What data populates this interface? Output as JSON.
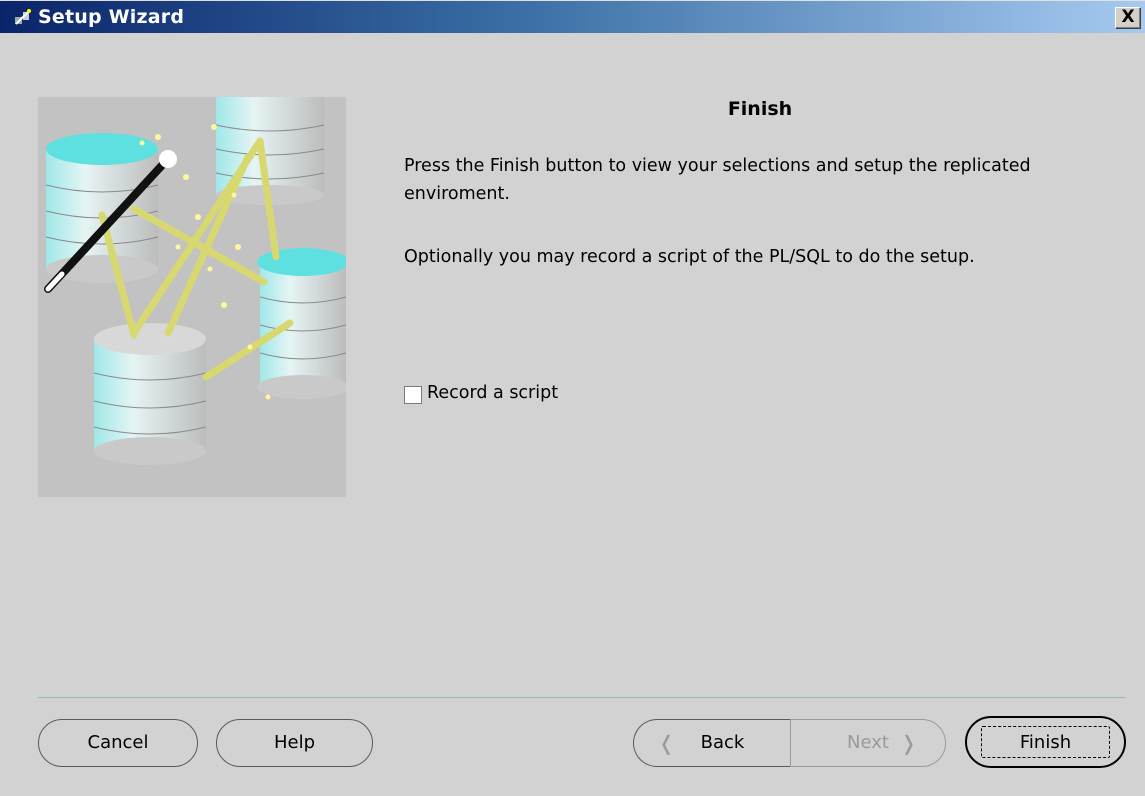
{
  "window": {
    "title": "Setup Wizard",
    "close_label": "X"
  },
  "page": {
    "heading": "Finish",
    "paragraph1": "Press the Finish button to view your selections and setup the replicated enviroment.",
    "paragraph2": "Optionally you may record a script of the PL/SQL to do the setup."
  },
  "options": {
    "record_script": {
      "label": "Record a script",
      "checked": false
    }
  },
  "buttons": {
    "cancel": "Cancel",
    "help": "Help",
    "back": "Back",
    "next": "Next",
    "finish": "Finish"
  },
  "icons": {
    "app": "wizard-icon",
    "back": "chevron-left-icon",
    "next": "chevron-right-icon"
  },
  "colors": {
    "title_start": "#0a246a",
    "title_end": "#a6caf0",
    "background": "#d2d2d2",
    "disabled_text": "#9a9a9a"
  }
}
